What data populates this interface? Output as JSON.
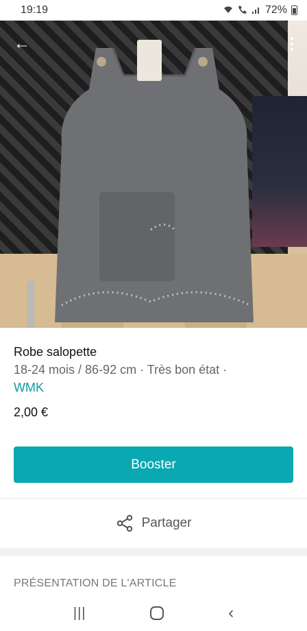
{
  "status_bar": {
    "time": "19:19",
    "battery": "72%",
    "icons": [
      "wifi-icon",
      "call-wifi-icon",
      "signal-icon",
      "battery-icon"
    ]
  },
  "photo": {
    "back_icon": "←",
    "more_icon": "more-vertical-icon"
  },
  "item": {
    "title": "Robe salopette",
    "meta": "18-24 mois / 86-92 cm · Très bon état ·",
    "brand": "WMK",
    "price": "2,00 €"
  },
  "actions": {
    "booster_label": "Booster",
    "share_label": "Partager"
  },
  "section": {
    "title": "PRÉSENTATION DE L'ARTICLE"
  },
  "nav": {
    "recent": "|||",
    "back": "‹"
  },
  "colors": {
    "accent": "#0aa8b0",
    "brand_text": "#0f9aa3"
  }
}
